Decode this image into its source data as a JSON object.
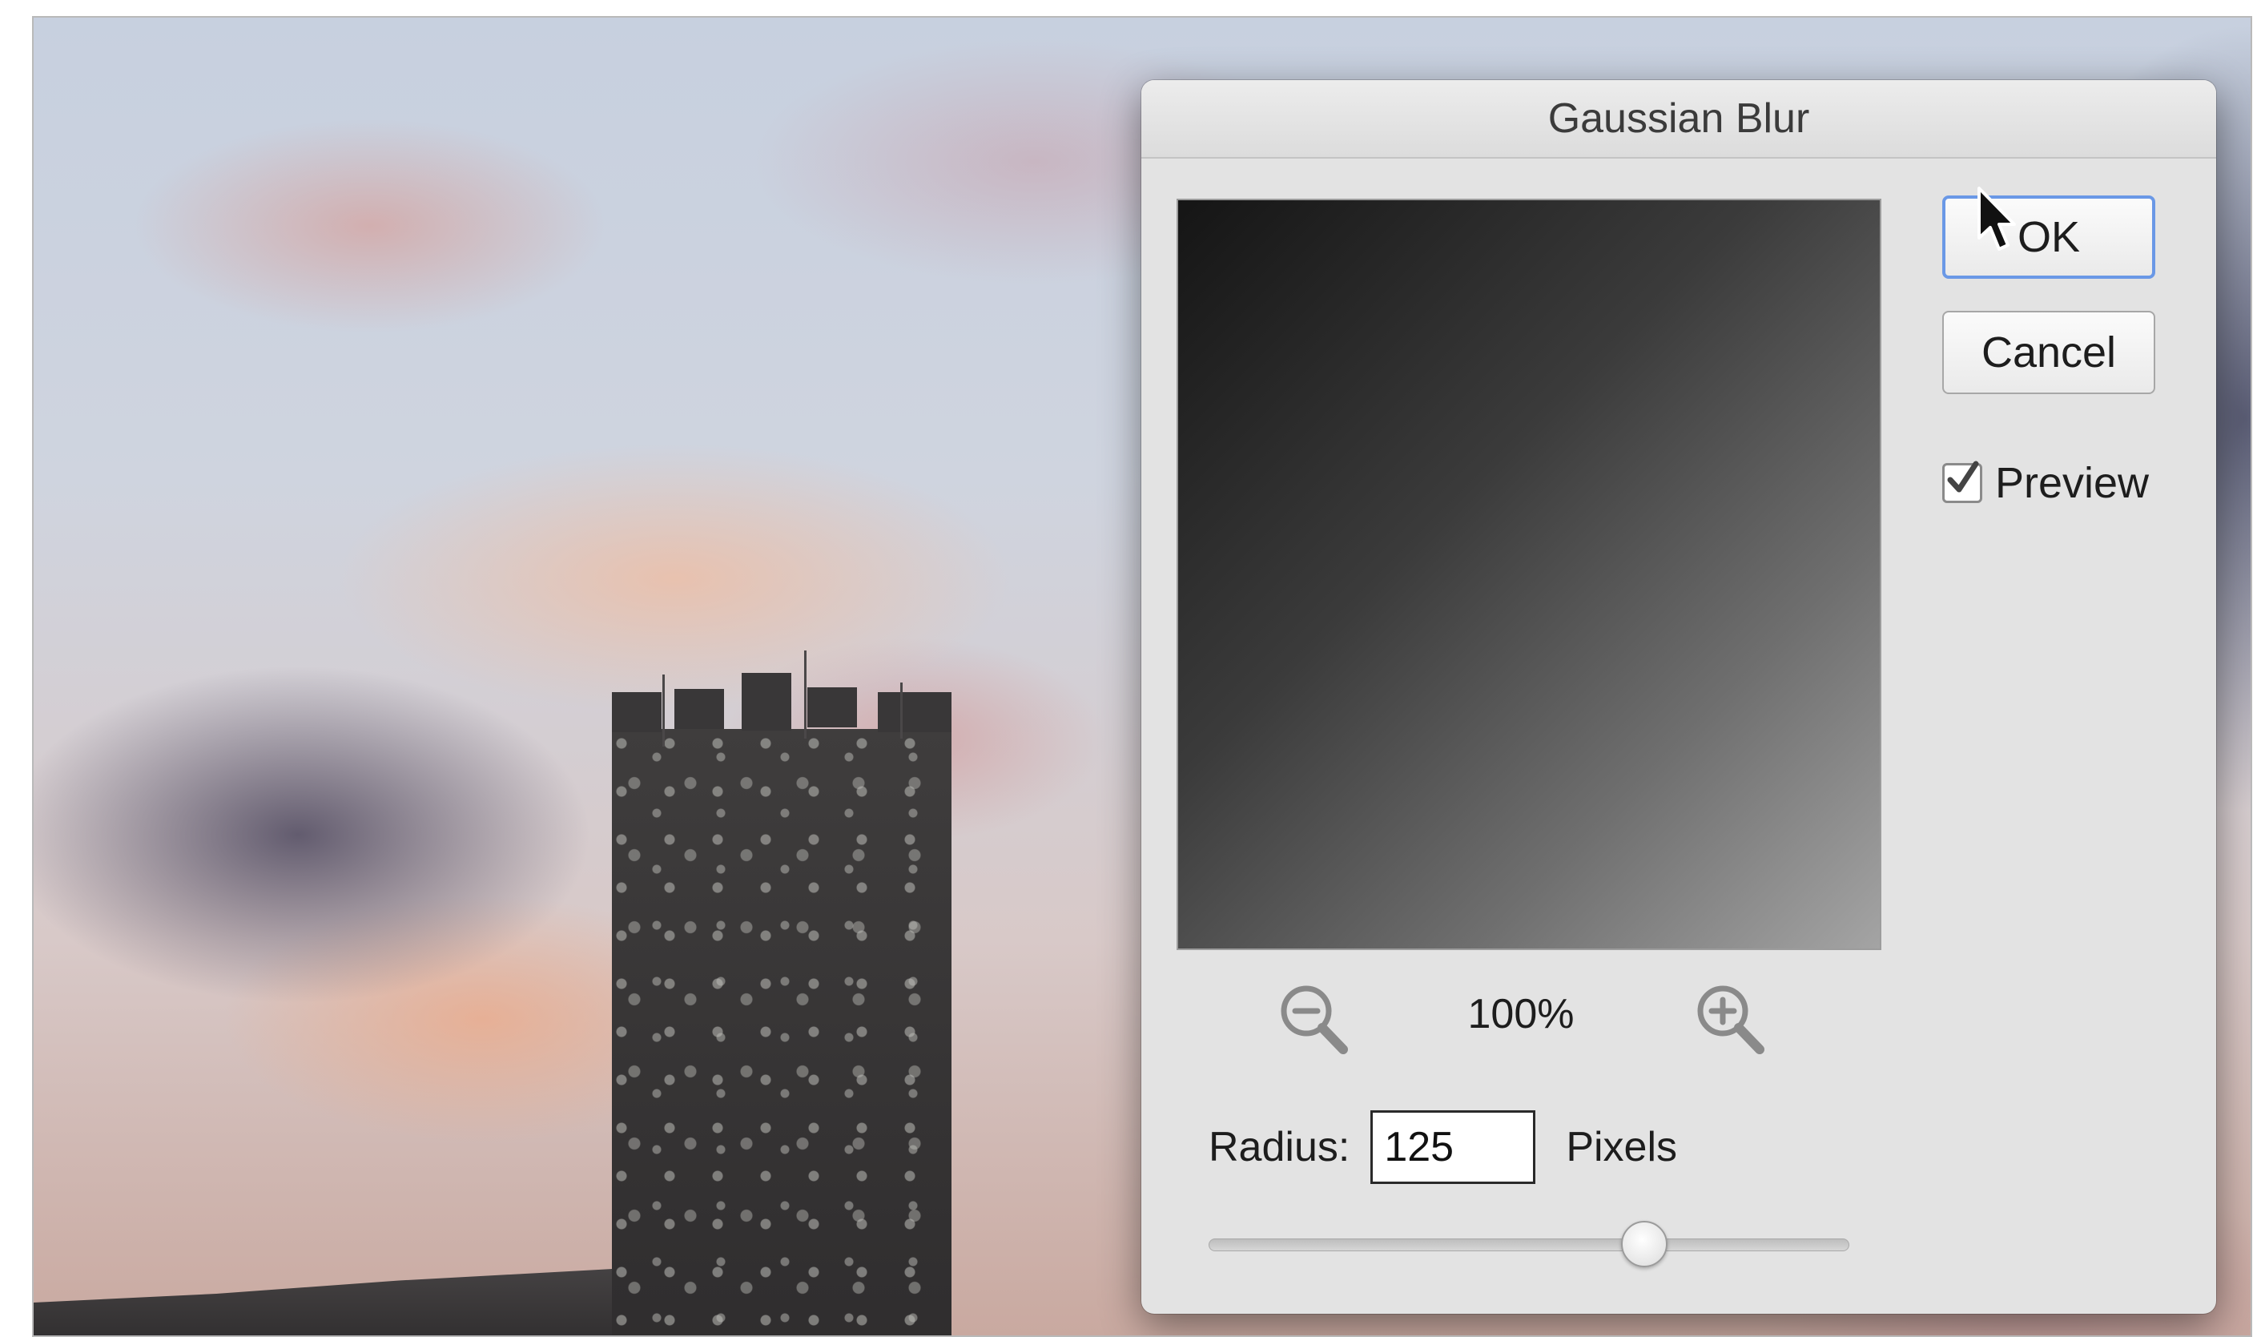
{
  "dialog": {
    "title": "Gaussian Blur",
    "ok_label": "OK",
    "cancel_label": "Cancel",
    "preview_label": "Preview",
    "preview_checked": true,
    "zoom_level": "100%",
    "zoom_out_icon": "zoom-out-icon",
    "zoom_in_icon": "zoom-in-icon",
    "radius_label": "Radius:",
    "radius_value": "125",
    "units_label": "Pixels",
    "radius_slider_fraction": 0.68
  },
  "colors": {
    "dialog_bg": "#e3e3e3",
    "default_button_border": "#6a98e6"
  }
}
